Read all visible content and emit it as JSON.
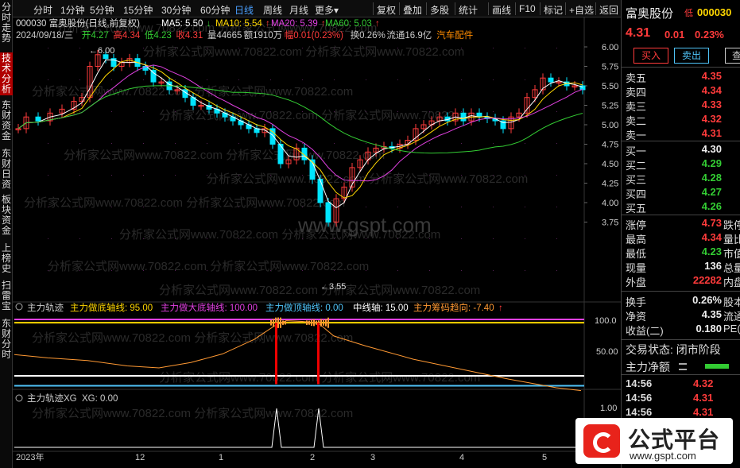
{
  "sidebar": {
    "tabs": [
      {
        "label": "分时走势",
        "active": false
      },
      {
        "label": "技术分析",
        "active": true
      },
      {
        "label": "东财资金",
        "active": false
      },
      {
        "label": "东财日资",
        "active": false
      },
      {
        "label": "板块资金",
        "active": false
      },
      {
        "label": "上榜史",
        "active": false
      },
      {
        "label": "扫雷宝",
        "active": false
      },
      {
        "label": "东财分时",
        "active": false
      }
    ]
  },
  "toolbar": {
    "periods": [
      "分时",
      "1分钟",
      "5分钟",
      "15分钟",
      "30分钟",
      "60分钟",
      "日线",
      "周线",
      "月线",
      "更多"
    ],
    "active_period": "日线",
    "more_arrow": "▾",
    "actions": [
      "复权",
      "叠加",
      "多股",
      "统计",
      "画线",
      "F10",
      "标记",
      "+自选",
      "返回"
    ]
  },
  "main": {
    "title_line": "000030 富奥股份(日线,前复权)",
    "ma": [
      {
        "label": "MA5: 5.50",
        "arrow": "↓",
        "color": "#ffffff"
      },
      {
        "label": "MA10: 5.54",
        "arrow": "↑",
        "color": "#ffd700"
      },
      {
        "label": "MA20: 5.39",
        "arrow": "↑",
        "color": "#e040e0"
      },
      {
        "label": "MA60: 5.03",
        "arrow": "↑",
        "color": "#33cc33"
      }
    ],
    "info": [
      {
        "t": "2024/09/18/三",
        "c": "#cccccc"
      },
      {
        "t": "开4.27",
        "c": "#33cc33"
      },
      {
        "t": "高4.34",
        "c": "#ff3b3b"
      },
      {
        "t": "低4.23",
        "c": "#33cc33"
      },
      {
        "t": "收4.31",
        "c": "#ff3b3b"
      },
      {
        "t": "量44665",
        "c": "#cccccc"
      },
      {
        "t": "额1910万",
        "c": "#cccccc"
      },
      {
        "t": "幅0.01(0.23%)",
        "c": "#ff3b3b"
      },
      {
        "t": "换0.26%",
        "c": "#cccccc"
      },
      {
        "t": "流通16.9亿",
        "c": "#cccccc"
      },
      {
        "t": "汽车配件",
        "c": "#ff8c00"
      }
    ],
    "yticks": [
      "6.00",
      "5.75",
      "5.50",
      "5.25",
      "5.00",
      "4.75",
      "4.50",
      "4.25",
      "4.00",
      "3.75"
    ],
    "high_label": "6.00",
    "low_label": "3.55",
    "high_arrow": "←",
    "low_arrow": "←",
    "watermarks": [
      "分析家公式网www.70822.com",
      "www.gspt.com"
    ]
  },
  "ind1": {
    "name": "主力轨迹",
    "items": [
      {
        "t": "主力做底轴线: 95.00",
        "c": "#ffd700"
      },
      {
        "t": "主力做大底轴线: 100.00",
        "c": "#e040e0"
      },
      {
        "t": "主力做顶轴线: 0.00",
        "c": "#4fc3f7"
      },
      {
        "t": "中线轴: 15.00",
        "c": "#ffffff"
      },
      {
        "t": "主力筹码趋向: -7.40",
        "c": "#ff9933"
      }
    ],
    "trend_arrow": "↑",
    "yticks": [
      "100.0",
      "50.00"
    ]
  },
  "ind2": {
    "name": "主力轨迹XG",
    "items": [
      {
        "t": "XG: 0.00",
        "c": "#cccccc"
      }
    ],
    "yticks": [
      "1.00"
    ]
  },
  "xaxis": [
    "2023年",
    "12",
    "1",
    "2",
    "3",
    "4",
    "5"
  ],
  "right": {
    "name": "富奥股份",
    "tag": "低",
    "code": "000030",
    "price": "4.31",
    "chg": "0.01",
    "pct": "0.23%",
    "buttons": [
      "买入",
      "卖出",
      "查"
    ],
    "asks": [
      {
        "l": "卖五",
        "v": "4.35"
      },
      {
        "l": "卖四",
        "v": "4.34"
      },
      {
        "l": "卖三",
        "v": "4.33"
      },
      {
        "l": "卖二",
        "v": "4.32"
      },
      {
        "l": "卖一",
        "v": "4.31"
      }
    ],
    "bids": [
      {
        "l": "买一",
        "v": "4.30"
      },
      {
        "l": "买二",
        "v": "4.29"
      },
      {
        "l": "买三",
        "v": "4.28"
      },
      {
        "l": "买四",
        "v": "4.27"
      },
      {
        "l": "买五",
        "v": "4.26"
      }
    ],
    "stats": [
      {
        "l": "涨停",
        "v": "4.73",
        "x": "跌停"
      },
      {
        "l": "最高",
        "v": "4.34",
        "x": "量比"
      },
      {
        "l": "最低",
        "v": "4.23",
        "x": "市值"
      },
      {
        "l": "现量",
        "v": "136",
        "x": "总量"
      },
      {
        "l": "外盘",
        "v": "22282",
        "x": "内盘"
      }
    ],
    "stats2": [
      {
        "l": "换手",
        "v": "0.26%",
        "x": "股本"
      },
      {
        "l": "净资",
        "v": "4.35",
        "x": "流通"
      },
      {
        "l": "收益(二)",
        "v": "0.180",
        "x": "PE("
      }
    ],
    "status": "交易状态: 闭市阶段",
    "net": "主力净额",
    "ticks": [
      {
        "t": "14:56",
        "p": "4.32"
      },
      {
        "t": "14:56",
        "p": "4.31"
      },
      {
        "t": "14:56",
        "p": "4.31"
      }
    ]
  },
  "logo": {
    "title": "公式平台",
    "url": "www.gspt.com"
  }
}
